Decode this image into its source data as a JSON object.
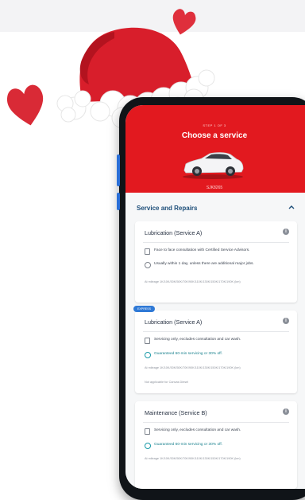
{
  "colors": {
    "brand_red": "#e2191f",
    "heading_blue": "#1d4e79",
    "teal": "#1a9aa8",
    "badge_blue": "#2f79d6"
  },
  "header": {
    "step": "STEP 1 OF 3",
    "title": "Choose a service",
    "plate": "SJK8265"
  },
  "section": {
    "title": "Service and Repairs",
    "icon": "chevron-up-icon"
  },
  "cards": [
    {
      "title": "Lubrication (Service A)",
      "badge": "",
      "items": [
        {
          "icon": "document-icon",
          "text": "Face to face consultation with Certified Service Advisors."
        },
        {
          "icon": "clock-icon",
          "text": "Usually within 1 day, unless there are additional major jobs."
        }
      ],
      "note": "At mileage 1K/10K/30K/50K/70K/90K/110K/130K/150K/170K/190K (km)"
    },
    {
      "title": "Lubrication (Service A)",
      "badge": "EXPRESS",
      "items": [
        {
          "icon": "document-icon",
          "text": "Servicing only, excludes consultation and car wash."
        },
        {
          "icon": "clock-icon",
          "text": "Guaranteed 60-min servicing or 30% off."
        }
      ],
      "note": "At mileage 1K/10K/30K/50K/70K/90K/110K/130K/150K/170K/190K (km)",
      "note2": "Not applicable for Canvas Diesel"
    },
    {
      "title": "Maintenance (Service B)",
      "badge": "",
      "items": [
        {
          "icon": "document-icon",
          "text": "Servicing only, excludes consultation and car wash."
        },
        {
          "icon": "clock-icon",
          "text": "Guaranteed 60-min servicing or 30% off."
        }
      ],
      "note": "At mileage 1K/10K/30K/50K/70K/90K/110K/130K/150K/170K/190K (km)"
    }
  ]
}
